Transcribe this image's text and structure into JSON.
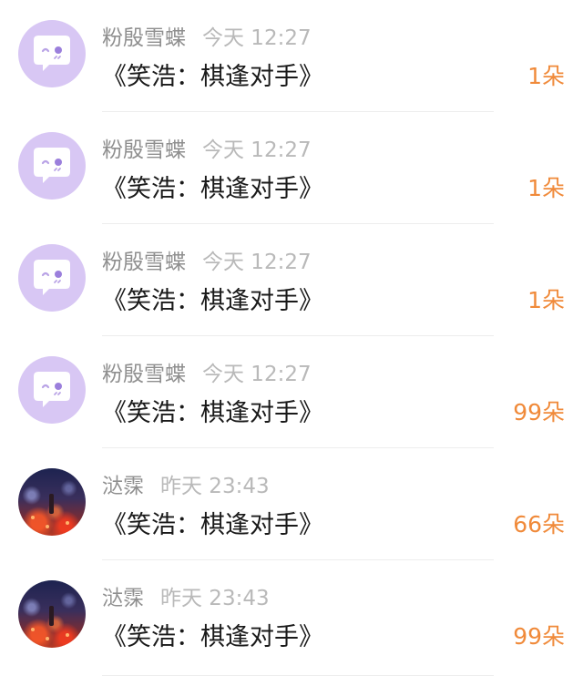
{
  "rows": [
    {
      "username": "粉殷雪蝶",
      "time": "今天 12:27",
      "message": "《笑浩：棋逢对手》",
      "count": "1朵",
      "avatar": "default-avatar-icon"
    },
    {
      "username": "粉殷雪蝶",
      "time": "今天 12:27",
      "message": "《笑浩：棋逢对手》",
      "count": "1朵",
      "avatar": "default-avatar-icon"
    },
    {
      "username": "粉殷雪蝶",
      "time": "今天 12:27",
      "message": "《笑浩：棋逢对手》",
      "count": "1朵",
      "avatar": "default-avatar-icon"
    },
    {
      "username": "粉殷雪蝶",
      "time": "今天 12:27",
      "message": "《笑浩：棋逢对手》",
      "count": "99朵",
      "avatar": "default-avatar-icon"
    },
    {
      "username": "㳠霂",
      "time": "昨天 23:43",
      "message": "《笑浩：棋逢对手》",
      "count": "66朵",
      "avatar": "user-photo-avatar"
    },
    {
      "username": "㳠霂",
      "time": "昨天 23:43",
      "message": "《笑浩：棋逢对手》",
      "count": "99朵",
      "avatar": "user-photo-avatar"
    }
  ],
  "colors": {
    "count": "#f08a3a",
    "username": "#8f8f8f",
    "time": "#b9b9b9",
    "message": "#1a1a1a",
    "default_avatar_bg": "#d8c7f4"
  }
}
